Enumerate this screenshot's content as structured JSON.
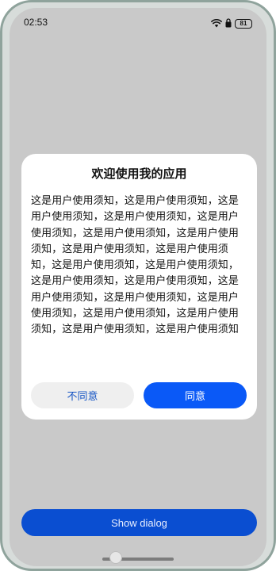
{
  "status_bar": {
    "time": "02:53",
    "battery": "81",
    "icons": [
      "wifi-icon",
      "battery-icon"
    ]
  },
  "dialog": {
    "title": "欢迎使用我的应用",
    "body": "这是用户使用须知，这是用户使用须知，这是用户使用须知，这是用户使用须知，这是用户使用须知，这是用户使用须知，这是用户使用须知，这是用户使用须知，这是用户使用须知，这是用户使用须知，这是用户使用须知，这是用户使用须知，这是用户使用须知，这是用户使用须知，这是用户使用须知，这是用户使用须知，这是用户使用须知，这是用户使用须知，这是用户使用须知，这是用户使用须知",
    "disagree_label": "不同意",
    "agree_label": "同意"
  },
  "main": {
    "show_dialog_label": "Show dialog"
  },
  "colors": {
    "accent": "#0a59f7",
    "overlay": "#c9c9c9",
    "disagree_text": "#1554c4"
  }
}
